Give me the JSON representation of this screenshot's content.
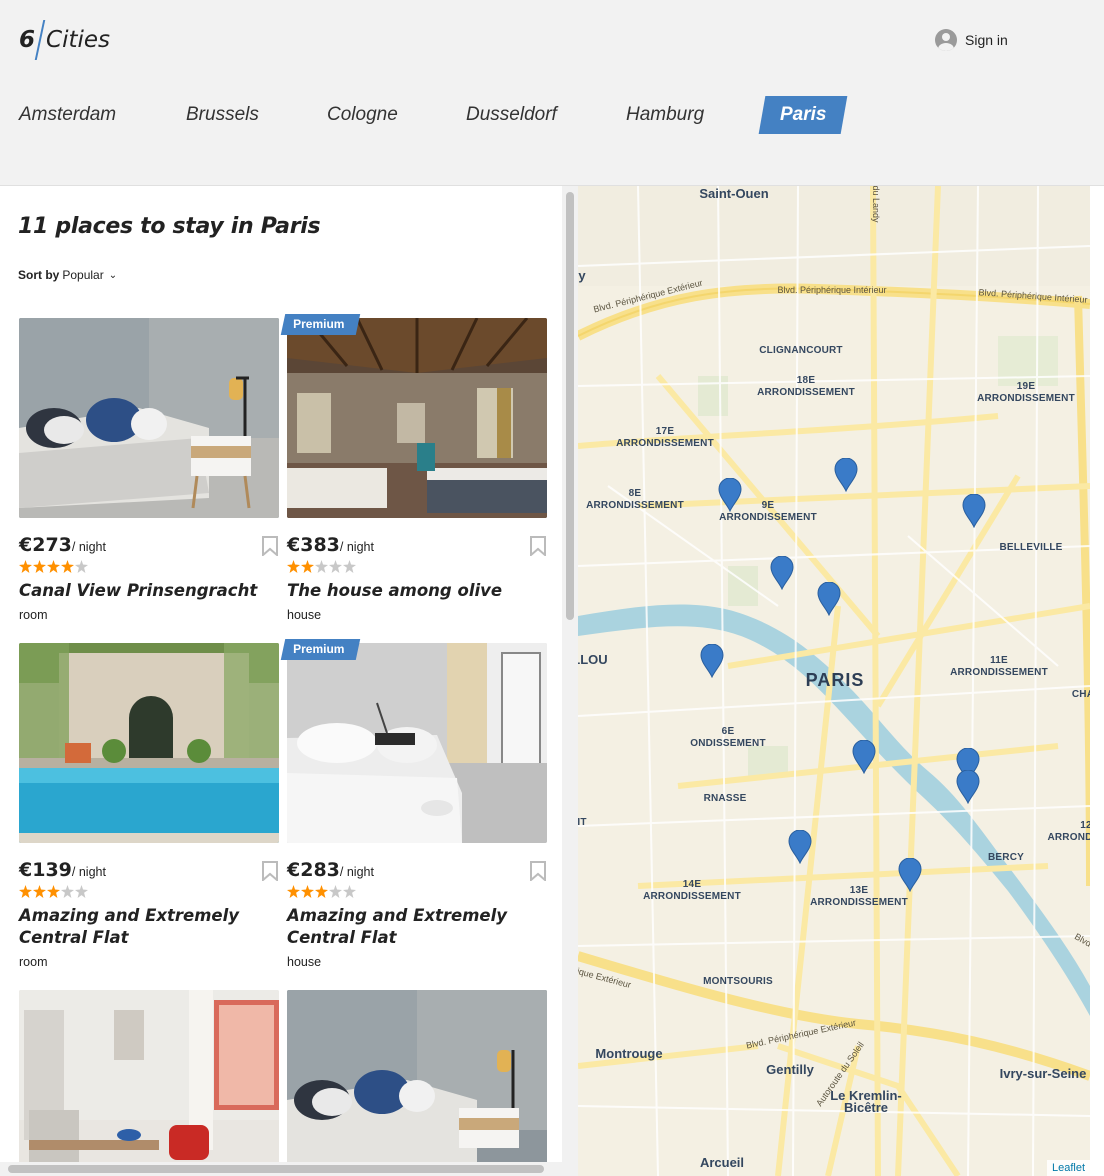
{
  "header": {
    "logo_number": "6",
    "logo_word": "Cities",
    "signin_label": "Sign in"
  },
  "tabs": [
    {
      "label": "Amsterdam",
      "active": false
    },
    {
      "label": "Brussels",
      "active": false
    },
    {
      "label": "Cologne",
      "active": false
    },
    {
      "label": "Dusseldorf",
      "active": false
    },
    {
      "label": "Hamburg",
      "active": false
    },
    {
      "label": "Paris",
      "active": true
    }
  ],
  "list": {
    "title": "11 places to stay in Paris",
    "sort_label": "Sort by",
    "sort_value": "Popular"
  },
  "offers": [
    {
      "premium": false,
      "premium_label": "",
      "price": "€273",
      "per_night": "/ night",
      "rating": 4,
      "name": "Canal View Prinsengracht",
      "type": "room",
      "image": "bedroom-grey"
    },
    {
      "premium": true,
      "premium_label": "Premium",
      "price": "€383",
      "per_night": "/ night",
      "rating": 2,
      "name": "The house among olive",
      "type": "house",
      "image": "rustic-room"
    },
    {
      "premium": false,
      "premium_label": "",
      "price": "€139",
      "per_night": "/ night",
      "rating": 3,
      "name": "Amazing and Extremely Central Flat",
      "type": "room",
      "image": "pool-courtyard"
    },
    {
      "premium": true,
      "premium_label": "Premium",
      "price": "€283",
      "per_night": "/ night",
      "rating": 3,
      "name": "Amazing and Extremely Central Flat",
      "type": "house",
      "image": "white-bedroom"
    },
    {
      "premium": false,
      "premium_label": "",
      "price": "",
      "per_night": "",
      "rating": 0,
      "name": "",
      "type": "",
      "image": "living-room"
    },
    {
      "premium": false,
      "premium_label": "",
      "price": "",
      "per_night": "",
      "rating": 0,
      "name": "",
      "type": "",
      "image": "bedroom-grey"
    }
  ],
  "map": {
    "labels": {
      "saint_ouen": "Saint-Ouen",
      "clignancourt": "CLIGNANCOURT",
      "a18": "18E\nARRONDISSEMENT",
      "a19": "19E\nARRONDISSEMENT",
      "a17": "17E\nARRONDISSEMENT",
      "a8": "8E\nARRONDISSEMENT",
      "a9": "9E\nARRONDISSEMENT",
      "belleville": "BELLEVILLE",
      "paris": "PARIS",
      "a11": "11E\nARRONDISSEMENT",
      "a6": "6E\nONDISSEMENT",
      "rnasse": "RNASSE",
      "bercy": "BERCY",
      "a14": "14E\nARRONDISSEMENT",
      "a13": "13E\nARRONDISSEMENT",
      "montsouris": "MONTSOURIS",
      "montrouge": "Montrouge",
      "gentilly": "Gentilly",
      "kremlin": "Le Kremlin-\nBicêtre",
      "ivry": "Ivry-sur-Seine",
      "arcueil": "Arcueil",
      "road_peri_int": "Blvd. Périphérique Intérieur",
      "road_peri_ext": "Blvd. Périphérique Extérieur",
      "road_peri_int2": "Blvd. Périphérique Intérieur",
      "road_peri_ext_s": "Blvd. Périphérique Extérieur",
      "road_ext_sw": "ique Extérieur",
      "road_a6": "Autoroute du Soleil",
      "road_landy": "du Landy",
      "y": "y",
      "llou": "LLOU",
      "it": "IT",
      "cha": "CHA",
      "arrond": "ARROND",
      "n12": "12",
      "blvd": "Blvd"
    },
    "marker_count": 10,
    "marker_color": "#3a7bc8",
    "attribution": "Leaflet"
  },
  "colors": {
    "accent": "#4481c3",
    "star_on": "#ff9000",
    "star_off": "#c8c8c8"
  }
}
